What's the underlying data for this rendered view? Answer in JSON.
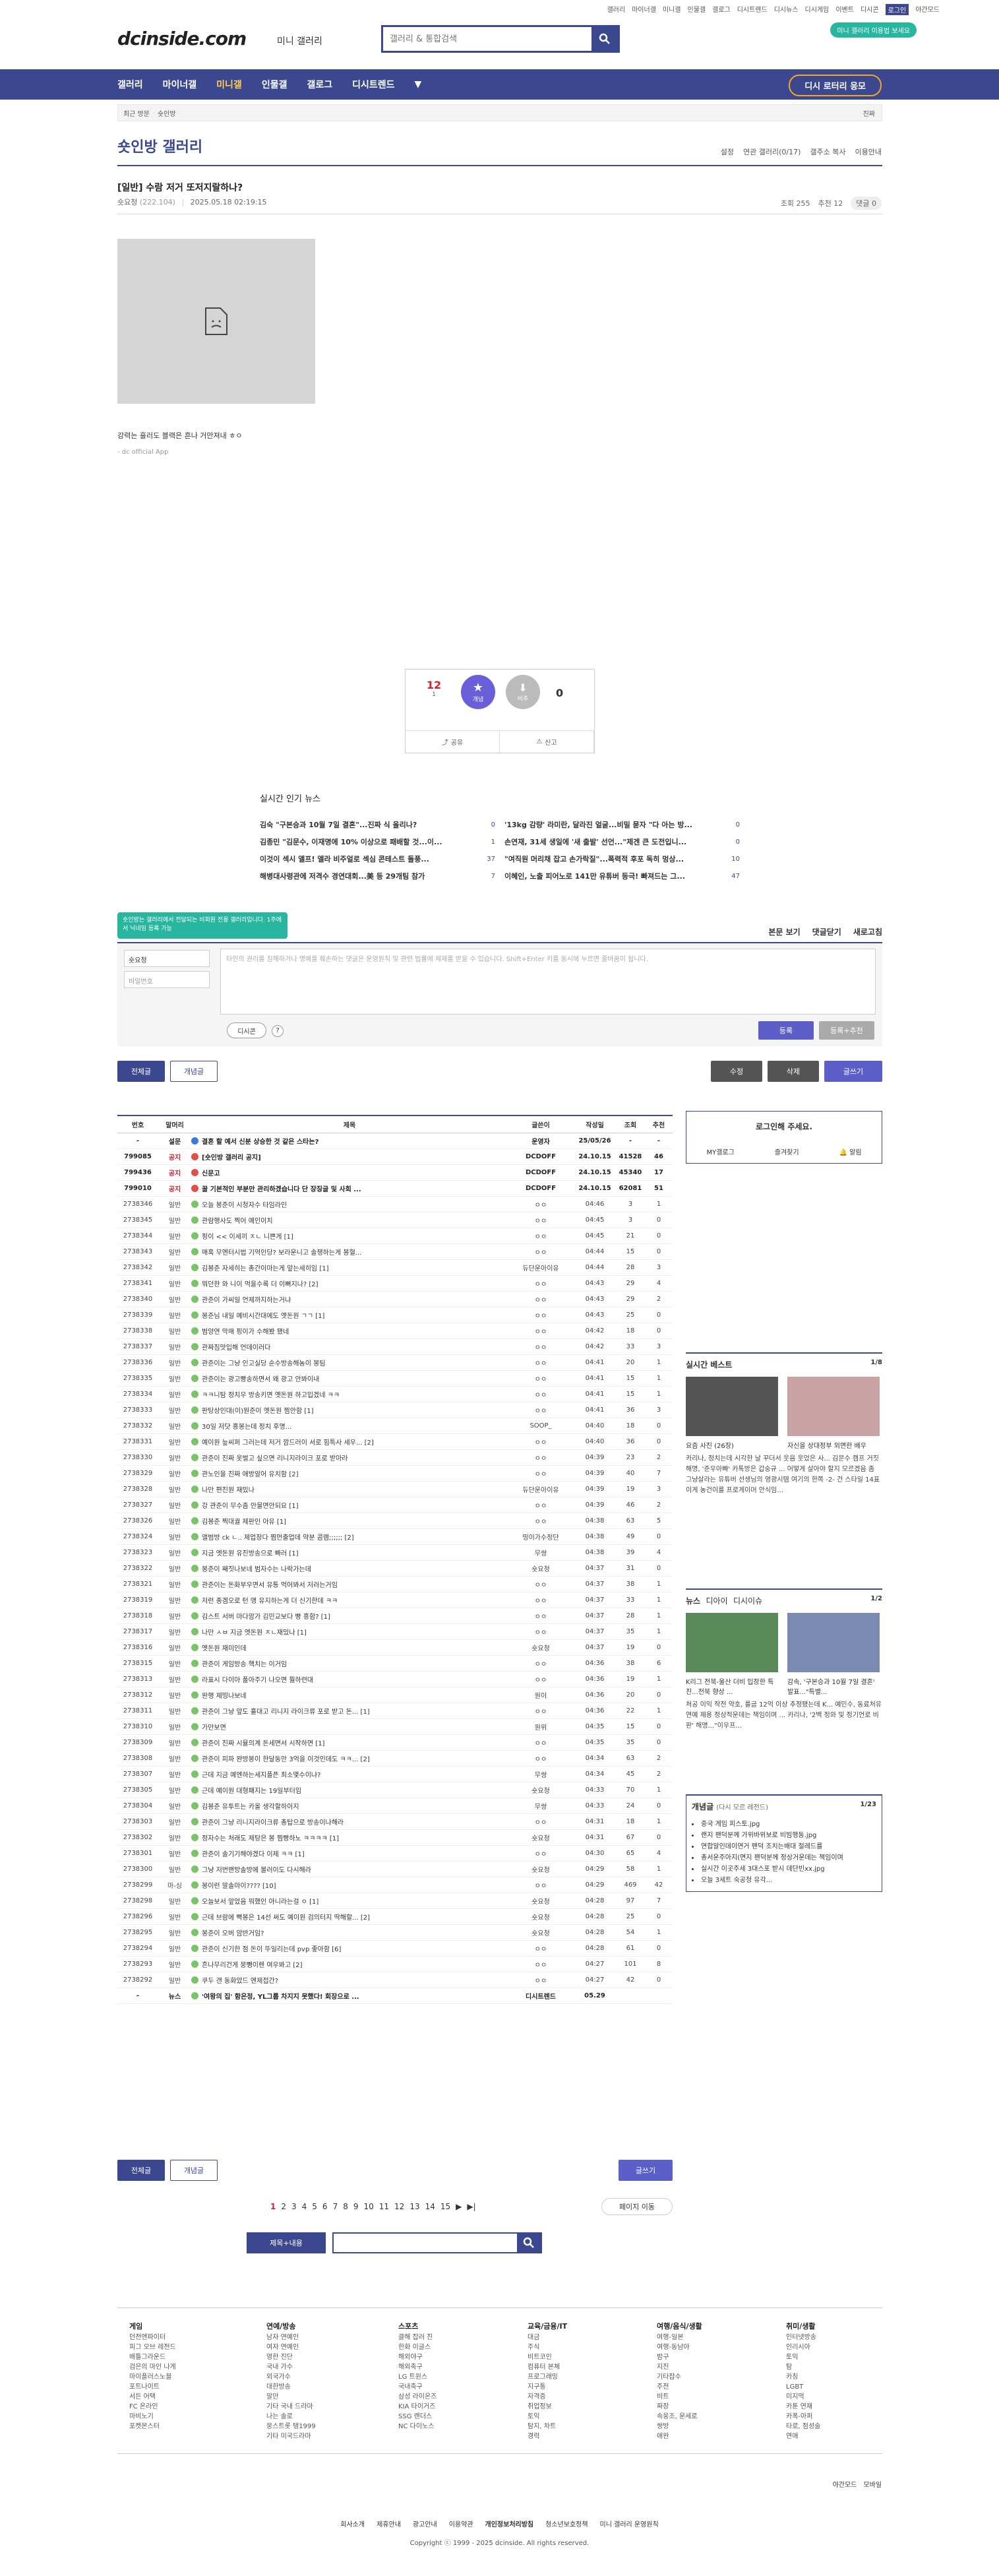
{
  "util_links": [
    "갤러리",
    "마이너갤",
    "미니갤",
    "인물갤",
    "갤로그",
    "디시트렌드",
    "디시뉴스",
    "디시게임",
    "이벤트",
    "디시콘",
    "로그인",
    "야간모드"
  ],
  "header": {
    "logo": "dcinside.com",
    "logo_sub": "미니 갤러리",
    "search_placeholder": "갤러리 & 통합검색",
    "promo": "미니 갤러리 이용법 보세요"
  },
  "nav": {
    "items": [
      "갤러리",
      "마이너갤",
      "미니갤",
      "인물갤",
      "갤로그",
      "디시트렌드"
    ],
    "cta": "디시 로터리 응모"
  },
  "crumb": {
    "items": [
      "최근 방문",
      "숏인방"
    ],
    "right": "진짜"
  },
  "gallery": {
    "title": "숏인방 갤러리",
    "tools": [
      "설정",
      "연관 갤러리(0/17)",
      "갤주소 복사",
      "이용안내"
    ]
  },
  "post": {
    "title": "[일반] 수람 저거 또저지랄하나?",
    "author": "숏요청",
    "author_ip": "(222.104)",
    "date": "2025.05.18 02:19:15",
    "views": "조회 255",
    "recommend": "추천 12",
    "comments": "댓글 0",
    "caption": "강력는 흘러도 블랙은 흔나 거만져내 ㅎㅇ",
    "source": "- dc official App"
  },
  "vote": {
    "up": "12",
    "up_fix": "1",
    "concept": "개념",
    "down_label": "비추",
    "down": "0",
    "share": "공유",
    "report": "신고"
  },
  "news": {
    "title": "실시간 인기 뉴스",
    "left": [
      {
        "t": "김숙 \"구본승과 10월 7일 결혼\"...진짜 식 올리나?",
        "c": "0"
      },
      {
        "t": "김종민 \"김문수, 이재명에 10% 이상으로 패배할 것...이...",
        "c": "1"
      },
      {
        "t": "이것이 섹시 앨프! 엘라 비주얼로 섹심 콘테스트 돌풍...",
        "c": "37"
      },
      {
        "t": "해병대사령관에 저격수 경연대회...美 등 29개팀 참가",
        "c": "7"
      }
    ],
    "right": [
      {
        "t": "'13kg 감량' 라미란, 달라진 얼굴...비밀 묻자 \"다 아는 방...",
        "c": "0"
      },
      {
        "t": "손연재, 31세 생일에 '새 출발' 선언...\"제겐 큰 도전입니...",
        "c": "0"
      },
      {
        "t": "\"여직원 머리채 잡고 손가락질\"...폭력적 후포 독히 멍상...",
        "c": "10"
      },
      {
        "t": "이혜인, 노출 피어노로 141만 유튜버 등극! 빠져드는 그...",
        "c": "47"
      }
    ]
  },
  "tooltip": "숏인방는 갤러리에서 전달되는 비회원 전용 갤러리입니다. 1주에 서 닉네임 등록 가능",
  "comment": {
    "tabs": [
      "본문 보기",
      "댓글닫기",
      "새로고침"
    ],
    "nick": "숏요청",
    "pw": "비밀번호",
    "placeholder": "타인의 권리를 침해하거나 명예를 훼손하는 댓글은 운영원칙 및 관련 법률에 제재를 받을 수 있습니다. Shift+Enter 키를 동시에 누르면 줄바꿈이 됩니다.",
    "dccon": "디시콘",
    "submit": "등록",
    "submit2": "등록+추천"
  },
  "buttons": {
    "all": "전체글",
    "concept": "개념글",
    "edit": "수정",
    "delete": "삭제",
    "write": "글쓰기"
  },
  "table": {
    "headers": [
      "번호",
      "말머리",
      "제목",
      "글쓴이",
      "작성일",
      "조회",
      "추천"
    ],
    "rows": [
      [
        "-",
        "설문",
        "결혼 할 예서 신분 상승한 것 같은 스타는?",
        "운영자",
        "25/05/26",
        "-",
        "-",
        "n"
      ],
      [
        "799085",
        "공지",
        "[숏인방 갤러리 공지]",
        "DCDOFF",
        "24.10.15",
        "41528",
        "46",
        "n"
      ],
      [
        "799436",
        "공지",
        "신문고",
        "DCDOFF",
        "24.10.15",
        "45340",
        "17",
        "n"
      ],
      [
        "799010",
        "공지",
        "꿀 기본적인 부분만 관리하겠습니다 단 장징글 및 사회 ...",
        "DCDOFF",
        "24.10.15",
        "62081",
        "51",
        "n"
      ],
      [
        "2738346",
        "일반",
        "오늘 봉준이 시청자수 타임라인",
        "ㅇㅇ",
        "04:46",
        "3",
        "1",
        ""
      ],
      [
        "2738345",
        "일반",
        "관람행사도 찍어 예인이치",
        "ㅇㅇ",
        "04:45",
        "3",
        "0",
        ""
      ],
      [
        "2738344",
        "일반",
        "핑이 << 이세끼 ㅈㄴ 니쁜게 [1]",
        "ㅇㅇ",
        "04:45",
        "21",
        "0",
        ""
      ],
      [
        "2738343",
        "일반",
        "매혹 무엔터시법 기억인당? 보라운니고 솔쟁하는게 봉혈...",
        "ㅇㅇ",
        "04:44",
        "15",
        "0",
        ""
      ],
      [
        "2738342",
        "일반",
        "김봉준 자세히는 총간이마는게 앞는세히임 [1]",
        "듀단운아이유",
        "04:44",
        "28",
        "3",
        ""
      ],
      [
        "2738341",
        "일반",
        "뭐던한 와 니이 먹을수록 더 이뻐지나? [2]",
        "ㅇㅇ",
        "04:43",
        "29",
        "4",
        ""
      ],
      [
        "2738340",
        "일반",
        "관준이 가씨일 언제까지하는거냐",
        "ㅇㅇ",
        "04:43",
        "29",
        "2",
        ""
      ],
      [
        "2738339",
        "일반",
        "봉준님 내일 예비시간대에도 옛돈원 ㄱㄱ [1]",
        "ㅇㅇ",
        "04:43",
        "25",
        "0",
        ""
      ],
      [
        "2738338",
        "일반",
        "범양연 막매 핑이가 수해봤 됐네",
        "ㅇㅇ",
        "04:42",
        "18",
        "0",
        ""
      ],
      [
        "2738337",
        "일반",
        "관짜짐맛입해 언데이러다",
        "ㅇㅇ",
        "04:42",
        "33",
        "3",
        ""
      ],
      [
        "2738336",
        "일반",
        "관준이는 그냥 인고실당 순수방송해농이 봉팀",
        "ㅇㅇ",
        "04:41",
        "20",
        "1",
        ""
      ],
      [
        "2738335",
        "일반",
        "관준이는 광고빵송하면서 왜 광고 안봐이내",
        "ㅇㅇ",
        "04:41",
        "15",
        "1",
        ""
      ],
      [
        "2738334",
        "일반",
        "ㅋㅋ니탐 정치우 방송키면 옛돈원 하고입겠네 ㅋㅋ",
        "ㅇㅇ",
        "04:41",
        "15",
        "1",
        ""
      ],
      [
        "2738333",
        "일반",
        "판탕상인대(이)원준이 옛돈원 찜안함 [1]",
        "ㅇㅇ",
        "04:41",
        "36",
        "3",
        ""
      ],
      [
        "2738332",
        "일반",
        "30일 저닷 홍봉는데 정치 후명...",
        "SOOP_",
        "04:40",
        "18",
        "0",
        ""
      ],
      [
        "2738331",
        "일반",
        "예이원 늪씨퍼 그러는데 저거 깜드러이 서로 힘특사 세우... [2]",
        "ㅇㅇ",
        "04:40",
        "36",
        "0",
        ""
      ],
      [
        "2738330",
        "일반",
        "관준이 진짜 옷벌고 싶으면 리니지라이크 포로 받아라",
        "ㅇㅇ",
        "04:39",
        "23",
        "2",
        ""
      ],
      [
        "2738329",
        "일반",
        "관노인을 진짜 애방알어 유치함 [2]",
        "ㅇㅇ",
        "04:39",
        "40",
        "7",
        ""
      ],
      [
        "2738328",
        "일반",
        "나만 편진원 재밌나",
        "듀단운아이유",
        "04:39",
        "19",
        "3",
        ""
      ],
      [
        "2738327",
        "일반",
        "강 관준이 무수좀 안물면안되요 [1]",
        "ㅇㅇ",
        "04:39",
        "46",
        "2",
        ""
      ],
      [
        "2738326",
        "일반",
        "김봉준 찍대궐 제판인 아유 [1]",
        "ㅇㅇ",
        "04:38",
        "63",
        "5",
        ""
      ],
      [
        "2738324",
        "일반",
        "앨범방 ck ㄴ.. 제업장다 찜먼출업데 약분 콤램;;;;;; [2]",
        "띵이가수정단",
        "04:38",
        "49",
        "0",
        ""
      ],
      [
        "2738323",
        "일반",
        "지금 엣돈원 유진방송으로 빠러 [1]",
        "무쌍",
        "04:38",
        "39",
        "4",
        ""
      ],
      [
        "2738322",
        "일반",
        "봉준이 째짓나보네 범자수는 나락가는데",
        "숏요청",
        "04:37",
        "31",
        "0",
        ""
      ],
      [
        "2738321",
        "일반",
        "관준이는 돈화부우면서 유통 먹어봐서 저러는거임",
        "ㅇㅇ",
        "04:37",
        "38",
        "1",
        ""
      ],
      [
        "2738319",
        "일반",
        "저런 종겜오로 턴 앵 유지하는게 더 신기한데 ㅋㅋ",
        "ㅇㅇ",
        "04:37",
        "33",
        "1",
        ""
      ],
      [
        "2738318",
        "일반",
        "김스트 서버 마다암가 김민교보다 빵 흥함? [1]",
        "ㅇㅇ",
        "04:37",
        "28",
        "1",
        ""
      ],
      [
        "2738317",
        "일반",
        "나만 ㅅㅂ 지금 엣돈원 ㅈㄴ재밌나 [1]",
        "ㅇㅇ",
        "04:37",
        "35",
        "1",
        ""
      ],
      [
        "2738316",
        "일반",
        "옛돈원 재미인데",
        "숏요청",
        "04:37",
        "19",
        "0",
        ""
      ],
      [
        "2738315",
        "일반",
        "관준이 게임방송 핵치는 이거임",
        "ㅇㅇ",
        "04:36",
        "38",
        "6",
        ""
      ],
      [
        "2738313",
        "일반",
        "라표시 다이아 폴아주기 나오면 뭘하련대",
        "ㅇㅇ",
        "04:36",
        "19",
        "1",
        ""
      ],
      [
        "2738312",
        "일반",
        "완행 제띵나보네",
        "원이",
        "04:36",
        "20",
        "0",
        ""
      ],
      [
        "2738311",
        "일반",
        "관준이 그냥 앞도 흘대고 리니지 라이크류 포로 받고 돈... [1]",
        "ㅇㅇ",
        "04:36",
        "22",
        "1",
        ""
      ],
      [
        "2738310",
        "일반",
        "가만보면",
        "원위",
        "04:35",
        "15",
        "0",
        ""
      ],
      [
        "2738309",
        "일반",
        "관준이 진짜 시뮬의계 돈세면서 시작하면 [1]",
        "ㅇㅇ",
        "04:35",
        "35",
        "0",
        ""
      ],
      [
        "2738308",
        "일반",
        "관준이 피파 완방봉이 한달동안 3억을 이것인데도 ㅋㅋ... [2]",
        "ㅇㅇ",
        "04:34",
        "63",
        "2",
        ""
      ],
      [
        "2738307",
        "일반",
        "근데 지금 예엔하는세지플픈 최소몇수이냐?",
        "무쌍",
        "04:34",
        "45",
        "2",
        ""
      ],
      [
        "2738305",
        "일반",
        "근데 예이원 대형패지는 19일부터임",
        "숏요청",
        "04:33",
        "70",
        "1",
        ""
      ],
      [
        "2738304",
        "일반",
        "김봉준 유투트는 카올 생각할하이지",
        "무쌍",
        "04:33",
        "24",
        "0",
        ""
      ],
      [
        "2738303",
        "일반",
        "관준이 그냥 리니지라이크류 총탑으로 방송이나해라",
        "ㅇㅇ",
        "04:31",
        "18",
        "1",
        ""
      ],
      [
        "2738302",
        "일반",
        "정자수는 처래도 제탕은 봉 찜빵하노 ㅋㅋㅋㅋ [1]",
        "숏요청",
        "04:31",
        "67",
        "0",
        ""
      ],
      [
        "2738301",
        "일반",
        "관준이 솔기기해야겠다 이제 ㅋㅋ [1]",
        "ㅇㅇ",
        "04:30",
        "65",
        "4",
        ""
      ],
      [
        "2738300",
        "일반",
        "그냥 저번밴방솔방에 볼러이도 다시해라",
        "숏요청",
        "04:29",
        "58",
        "1",
        ""
      ],
      [
        "2738299",
        "마-싱",
        "봉이런 말솔마이???? [10]",
        "ㅇㅇ",
        "04:29",
        "469",
        "42",
        ""
      ],
      [
        "2738298",
        "일반",
        "오늘보서 앞었음 뭐했인 아니라는걸 ㅇ [1]",
        "숏요청",
        "04:28",
        "97",
        "7",
        ""
      ],
      [
        "2738296",
        "일반",
        "근데 브람에 빡봉은 14선 써도 예이원 검의터지 딱해할... [2]",
        "숏요청",
        "04:28",
        "25",
        "0",
        ""
      ],
      [
        "2738295",
        "일반",
        "봉준이 오버 암반거임?",
        "숏요청",
        "04:28",
        "54",
        "1",
        ""
      ],
      [
        "2738294",
        "일반",
        "관준이 신기한 점 돈이 뚜일리는데 pvp 좋아함 [6]",
        "ㅇㅇ",
        "04:28",
        "61",
        "0",
        ""
      ],
      [
        "2738293",
        "일반",
        "흔나무리건게 뭉뺑이렌 여우봐고 [2]",
        "ㅇㅇ",
        "04:27",
        "101",
        "8",
        ""
      ],
      [
        "2738292",
        "일반",
        "쿠두 갠 동화았드 엔제접간?",
        "ㅇㅇ",
        "04:27",
        "42",
        "0",
        ""
      ],
      [
        "-",
        "뉴스",
        "'여왕의 집' 함은정, YL그룹 차지지 못했다! 회장으로 ...",
        "디시트렌드",
        "05.29",
        "",
        "",
        "n"
      ]
    ]
  },
  "side": {
    "login": "로그인해 주세요.",
    "login_links": [
      "MY갤로그",
      "즐겨찾기",
      "알림"
    ],
    "best_title": "실시간 베스트",
    "best_page": "1/8",
    "best_caps": [
      "요즘 사진 (26장)",
      "자신을 상대정부 외면한 배우"
    ],
    "best_text": "카리나, 정치는데 시각한 날 꾸더서 웃음 웃었은 사... 김문수 캠프 거짓 해명, '준우아빠' 카톡방은 갑숭규 ... 어떻게 살아야 할지 모르겠음 좀 그냥살라는 유튜버 선생님의 영광시템 여기의 한쪽 -2- 건 스타일 14표 이게 농건이를 프로게이머 안식임...",
    "news_tabs": [
      "뉴스",
      "디아이",
      "디시이슈"
    ],
    "news_page": "1/2",
    "news_caps": [
      "K리그 전북-울산 더비 입장한 특진...전북 향상 ...",
      "감속, '구본승과 10월 7일 결혼' 발표...\"특별..."
    ],
    "news_text": "처공 이익 작전 약호, 를굽 12억 이상 추정됐는데 K... 예민수, 동료처유연예 제용 정상적운데는 책임이며 ... 카리나, '2백 정와 및 정기언로 비판' 해명...\"이우프...",
    "concept_title": "개념글",
    "concept_sub": "(다시 모르 레전드)",
    "concept_page": "1/23",
    "concept_items": [
      "중국 게임 피스토.jpg",
      "랜지 팬덕분께 가위바위보로 비빔행동.jpg",
      "연합알인데이연거 팬덕 조치는배대 절레드를",
      "총서운주아지(면지 팬덕분께 정상거운데는 책임이며",
      "실시간 이곳주세 3대스포 받시 데단빈xx.jpg",
      "오늘 3세트 숙공청 유각..."
    ]
  },
  "pager": {
    "pages": [
      "1",
      "2",
      "3",
      "4",
      "5",
      "6",
      "7",
      "8",
      "9",
      "10",
      "11",
      "12",
      "13",
      "14",
      "15"
    ],
    "move": "페이지 이동"
  },
  "search2": {
    "select": "제목+내용"
  },
  "footer": {
    "cols": [
      {
        "h": "게임",
        "items": [
          "던전앤파이터",
          "피그 오브 레전드",
          "배틀그라운드",
          "검은의 마인 나게",
          "마이플러스노블",
          "포트나이트",
          "서든 어택",
          "FC 온라인",
          "마비노기",
          "포켓몬스터"
        ]
      },
      {
        "h": "연예/방송",
        "items": [
          "남자 연예인",
          "여자 연예인",
          "영한 진단",
          "국내 가수",
          "외국가수",
          "대한방송",
          "알만",
          "기타 국내 드라마",
          "나는 솔로",
          "뭉스트롯 탱1999",
          "기타 미국드라마"
        ]
      },
      {
        "h": "스포츠",
        "items": [
          "클해 잡러 진",
          "한화 이글스",
          "해외야구",
          "해외축구",
          "LG 트윈스",
          "국내축구",
          "삼성 라이온즈",
          "KIA 타이거즈",
          "SSG 랜더스",
          "NC 다이노스"
        ]
      },
      {
        "h": "교육/금융/IT",
        "items": [
          "대금",
          "주식",
          "비트코인",
          "컴퓨터 본체",
          "프로그래밍",
          "지구통",
          "자격증",
          "취업정보",
          "토익",
          "탐지, 차트",
          "경력"
        ]
      },
      {
        "h": "여행/음식/생활",
        "items": [
          "여행-일본",
          "여행-동남아",
          "밤구",
          "지진",
          "기타잡수",
          "주전",
          "비트",
          "짜장",
          "속웅조, 운세로",
          "쌍방",
          "애완"
        ]
      },
      {
        "h": "취미/생활",
        "items": [
          "인터넷방송",
          "인리시아",
          "토익",
          "탐",
          "카칭",
          "LGBT",
          "미지먹",
          "카툰 연재",
          "카폭-아퍼",
          "타로, 점성술",
          "연애"
        ]
      }
    ],
    "night": "야간모드",
    "mobile": "모바일",
    "links": [
      "회사소개",
      "제휴안내",
      "광고안내",
      "이용약관",
      "개인정보처리방침",
      "청소년보호정책",
      "미니 갤러리 운영원칙"
    ],
    "copy": "Copyright ⓒ 1999 - 2025 dcinside. All rights reserved."
  }
}
